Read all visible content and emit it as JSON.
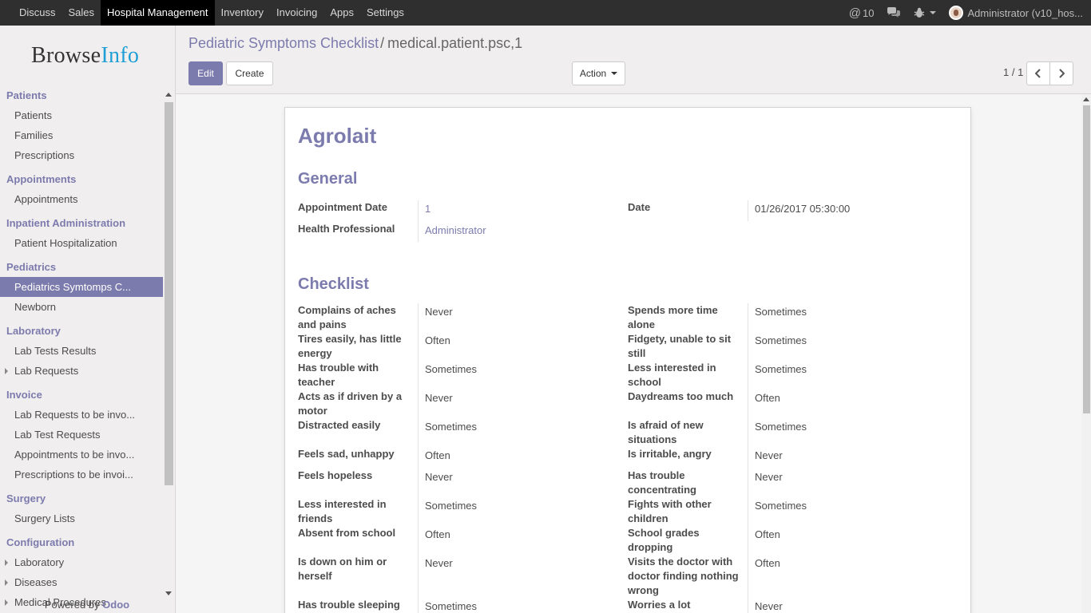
{
  "topbar": {
    "menu": [
      "Discuss",
      "Sales",
      "Hospital Management",
      "Inventory",
      "Invoicing",
      "Apps",
      "Settings"
    ],
    "active": "Hospital Management",
    "mentions": "10",
    "user": "Administrator (v10_hos..."
  },
  "logo": {
    "part1": "Browse",
    "part2": "Info"
  },
  "sidebar": {
    "sections": [
      {
        "title": "Patients",
        "items": [
          {
            "label": "Patients"
          },
          {
            "label": "Families"
          },
          {
            "label": "Prescriptions"
          }
        ]
      },
      {
        "title": "Appointments",
        "items": [
          {
            "label": "Appointments"
          }
        ]
      },
      {
        "title": "Inpatient Administration",
        "items": [
          {
            "label": "Patient Hospitalization"
          }
        ]
      },
      {
        "title": "Pediatrics",
        "items": [
          {
            "label": "Pediatrics Symtomps C...",
            "selected": true
          },
          {
            "label": "Newborn"
          }
        ]
      },
      {
        "title": "Laboratory",
        "items": [
          {
            "label": "Lab Tests Results"
          },
          {
            "label": "Lab Requests",
            "expandable": true
          }
        ]
      },
      {
        "title": "Invoice",
        "items": [
          {
            "label": "Lab Requests to be invo..."
          },
          {
            "label": "Lab Test Requests"
          },
          {
            "label": "Appointments to be invo..."
          },
          {
            "label": "Prescriptions to be invoi..."
          }
        ]
      },
      {
        "title": "Surgery",
        "items": [
          {
            "label": "Surgery Lists"
          }
        ]
      },
      {
        "title": "Configuration",
        "items": [
          {
            "label": "Laboratory",
            "expandable": true
          },
          {
            "label": "Diseases",
            "expandable": true
          },
          {
            "label": "Medical Procedures",
            "expandable": true
          }
        ]
      }
    ],
    "powered_prefix": "Powered by ",
    "powered_brand": "Odoo"
  },
  "control": {
    "breadcrumb_parent": "Pediatric Symptoms Checklist",
    "breadcrumb_sep": "/",
    "breadcrumb_current": "medical.patient.psc,1",
    "edit": "Edit",
    "create": "Create",
    "action": "Action",
    "pager": "1 / 1"
  },
  "form": {
    "title": "Agrolait",
    "general_heading": "General",
    "appointment_date_label": "Appointment Date",
    "appointment_date": "1",
    "date_label": "Date",
    "date": "01/26/2017 05:30:00",
    "health_professional_label": "Health Professional",
    "health_professional": "Administrator",
    "checklist_heading": "Checklist",
    "checklist": [
      {
        "left_label": "Complains of aches and pains",
        "left_value": "Never",
        "right_label": "Spends more time alone",
        "right_value": "Sometimes"
      },
      {
        "left_label": "Tires easily, has little energy",
        "left_value": "Often",
        "right_label": "Fidgety, unable to sit still",
        "right_value": "Sometimes"
      },
      {
        "left_label": "Has trouble with teacher",
        "left_value": "Sometimes",
        "right_label": "Less interested in school",
        "right_value": "Sometimes"
      },
      {
        "left_label": "Acts as if driven by a motor",
        "left_value": "Never",
        "right_label": "Daydreams too much",
        "right_value": "Often"
      },
      {
        "left_label": "Distracted easily",
        "left_value": "Sometimes",
        "right_label": "Is afraid of new situations",
        "right_value": "Sometimes"
      },
      {
        "left_label": "Feels sad, unhappy",
        "left_value": "Often",
        "right_label": "Is irritable, angry",
        "right_value": "Never"
      },
      {
        "left_label": "Feels hopeless",
        "left_value": "Never",
        "right_label": "Has trouble concentrating",
        "right_value": "Never"
      },
      {
        "left_label": "Less interested in friends",
        "left_value": "Sometimes",
        "right_label": "Fights with other children",
        "right_value": "Sometimes"
      },
      {
        "left_label": "Absent from school",
        "left_value": "Often",
        "right_label": "School grades dropping",
        "right_value": "Often"
      },
      {
        "left_label": "Is down on him or herself",
        "left_value": "Never",
        "right_label": "Visits the doctor with doctor finding nothing wrong",
        "right_value": "Often"
      },
      {
        "left_label": "Has trouble sleeping",
        "left_value": "Sometimes",
        "right_label": "Worries a lot",
        "right_value": "Never"
      }
    ]
  },
  "colors": {
    "accent": "#7c7bad",
    "navbar": "#2f2f2f",
    "logo_blue": "#1f9fd6"
  }
}
